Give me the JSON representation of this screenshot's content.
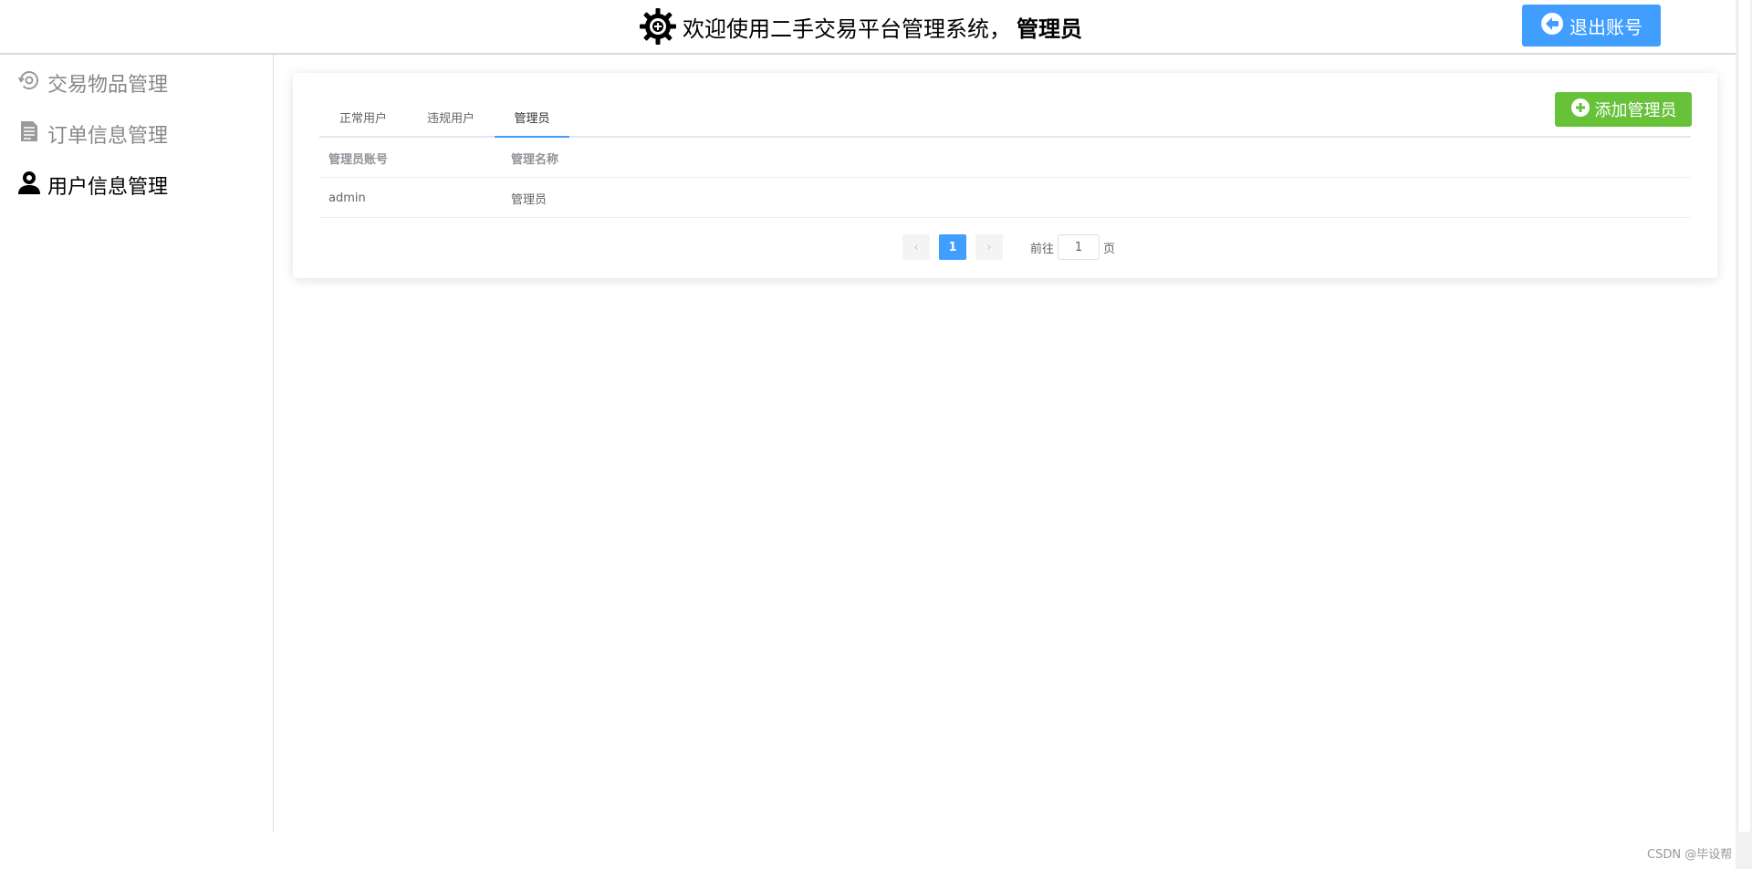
{
  "header": {
    "title_prefix": "欢迎使用二手交易平台管理系统，",
    "title_user": "管理员",
    "logout_label": "退出账号",
    "logo_icon": "gear-icon",
    "logout_icon": "arrow-left-icon"
  },
  "sidebar": {
    "items": [
      {
        "label": "交易物品管理",
        "icon": "goods-icon",
        "active": false
      },
      {
        "label": "订单信息管理",
        "icon": "document-icon",
        "active": false
      },
      {
        "label": "用户信息管理",
        "icon": "user-icon",
        "active": true
      }
    ]
  },
  "tabs": [
    {
      "label": "正常用户"
    },
    {
      "label": "违规用户"
    },
    {
      "label": "管理员"
    }
  ],
  "add_button": {
    "label": "添加管理员",
    "icon": "add-circle-icon"
  },
  "table": {
    "columns": [
      "管理员账号",
      "管理名称"
    ],
    "rows": [
      [
        "admin",
        "管理员"
      ]
    ]
  },
  "pagination": {
    "current_page": "1",
    "goto_prefix": "前往",
    "goto_value": "1",
    "goto_suffix": "页"
  },
  "watermark": "CSDN @毕设帮",
  "colors": {
    "primary": "#409eff",
    "success": "#67c23a"
  }
}
